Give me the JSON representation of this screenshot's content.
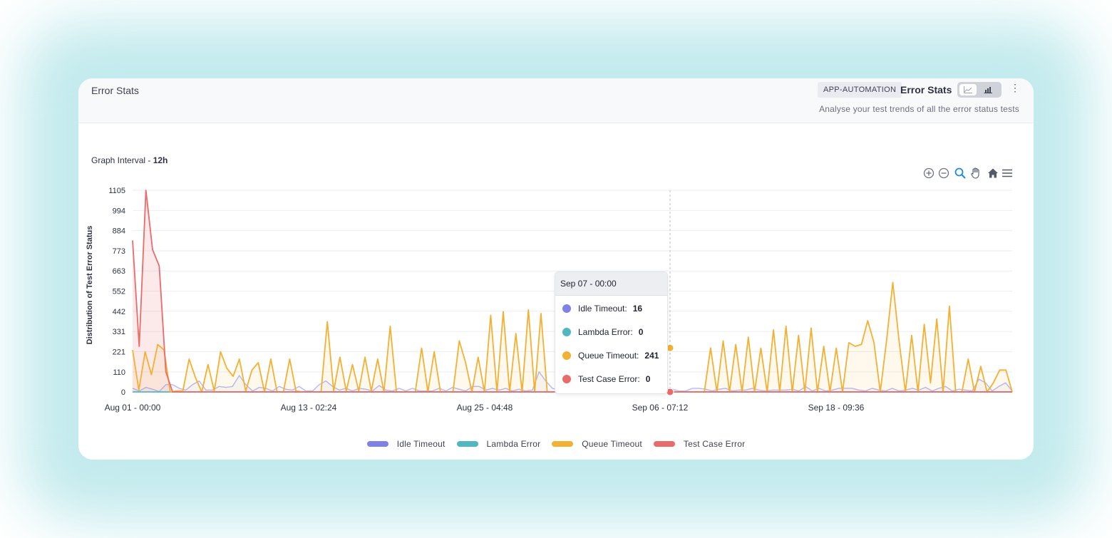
{
  "card": {
    "title": "Error Stats",
    "tag": "APP-AUTOMATION",
    "header_title": "Error Stats",
    "subtitle": "Analyse your test trends of all the error status tests",
    "interval_label": "Graph Interval - ",
    "interval_value": "12h"
  },
  "toolbar": {
    "icons": [
      "zoom-in-icon",
      "zoom-out-icon",
      "zoom-selection-icon",
      "pan-hand-icon",
      "home-reset-icon",
      "menu-icon"
    ]
  },
  "tooltip": {
    "title": "Sep 07 - 00:00",
    "rows": [
      {
        "label": "Idle Timeout:",
        "value": "16",
        "color": "#7f81e6"
      },
      {
        "label": "Lambda Error:",
        "value": "0",
        "color": "#4fb7c1"
      },
      {
        "label": "Queue Timeout:",
        "value": "241",
        "color": "#f2b134"
      },
      {
        "label": "Test Case Error:",
        "value": "0",
        "color": "#ea6b6b"
      }
    ]
  },
  "chart_data": {
    "type": "area",
    "ylabel": "Distribution of Test Error Status",
    "y_ticks": [
      "0",
      "110",
      "221",
      "331",
      "442",
      "552",
      "663",
      "773",
      "884",
      "994",
      "1105"
    ],
    "x_ticks": [
      "Aug 01 - 00:00",
      "Aug 13 - 02:24",
      "Aug 25 - 04:48",
      "Sep 06 - 07:12",
      "Sep 18 - 09:36"
    ],
    "ylim": [
      0,
      1105
    ],
    "x_range_hours": [
      0,
      1488
    ],
    "grid": true,
    "legend": "bottom-center",
    "series": [
      {
        "name": "Idle Timeout",
        "color": "#7f81e6",
        "values": [
          20,
          5,
          25,
          15,
          2,
          40,
          40,
          20,
          10,
          40,
          60,
          10,
          10,
          30,
          25,
          30,
          90,
          40,
          5,
          25,
          20,
          5,
          30,
          15,
          10,
          30,
          5,
          5,
          40,
          60,
          30,
          10,
          20,
          5,
          20,
          15,
          5,
          35,
          10,
          5,
          20,
          5,
          20,
          5,
          5,
          5,
          20,
          5,
          25,
          15,
          5,
          30,
          30,
          10,
          20,
          10,
          20,
          5,
          15,
          5,
          10,
          110,
          60,
          20,
          10,
          20,
          5,
          10,
          10,
          20,
          5,
          10,
          25,
          10,
          10,
          5,
          20,
          10,
          5,
          5,
          20,
          15,
          5,
          5,
          20,
          20,
          15,
          5,
          15,
          20,
          5,
          10,
          10,
          20,
          10,
          5,
          10,
          10,
          10,
          15,
          5,
          30,
          5,
          20,
          5,
          10,
          20,
          20,
          20,
          10,
          5,
          20,
          10,
          5,
          20,
          5,
          10,
          20,
          10,
          25,
          5,
          20,
          30,
          5,
          15,
          10,
          5,
          70,
          50,
          5,
          30,
          50,
          5
        ]
      },
      {
        "name": "Lambda Error",
        "color": "#4fb7c1",
        "values": [
          0,
          0,
          0,
          0,
          0,
          0,
          0,
          0,
          0,
          0,
          0,
          0,
          0,
          0,
          0,
          0,
          0,
          0,
          0,
          0,
          0,
          0,
          0,
          0,
          0,
          0,
          0,
          0,
          0,
          0,
          0,
          0,
          0,
          0,
          0,
          0,
          0,
          0,
          0,
          0,
          0,
          0,
          0,
          0,
          0,
          0,
          0,
          0,
          0,
          0,
          0,
          0,
          0,
          0,
          0,
          0,
          0,
          0,
          0,
          0,
          0,
          0,
          0,
          0,
          0,
          0,
          0,
          0,
          0,
          0,
          0,
          0,
          0,
          0,
          0,
          0,
          0,
          0,
          0,
          0,
          0,
          0,
          0,
          0,
          0,
          0,
          0,
          0,
          0,
          0,
          0,
          0,
          0,
          0,
          0,
          0,
          0,
          0,
          0,
          0,
          0,
          0,
          0,
          0,
          0,
          0,
          0,
          0,
          0,
          0,
          0,
          0,
          0,
          0,
          0,
          0,
          0,
          0,
          0,
          0,
          0,
          0,
          0,
          0,
          0,
          0,
          0,
          0,
          0,
          0,
          0,
          0,
          0,
          0
        ]
      },
      {
        "name": "Queue Timeout",
        "color": "#f2b134",
        "values": [
          230,
          10,
          220,
          95,
          260,
          230,
          0,
          5,
          5,
          180,
          80,
          0,
          150,
          5,
          220,
          130,
          85,
          180,
          5,
          120,
          160,
          0,
          180,
          0,
          0,
          180,
          5,
          0,
          0,
          0,
          0,
          385,
          5,
          190,
          5,
          150,
          5,
          190,
          5,
          180,
          0,
          360,
          0,
          0,
          0,
          0,
          240,
          0,
          220,
          0,
          0,
          0,
          280,
          160,
          0,
          190,
          0,
          420,
          0,
          440,
          0,
          320,
          0,
          450,
          0,
          430,
          0,
          0,
          0,
          0,
          0,
          0,
          0,
          0,
          0,
          0,
          0,
          0,
          0,
          0,
          0,
          0,
          0,
          0,
          0,
          0,
          0,
          0,
          0,
          0,
          0,
          0,
          241,
          0,
          280,
          0,
          260,
          0,
          300,
          0,
          240,
          0,
          340,
          0,
          360,
          0,
          310,
          0,
          350,
          0,
          250,
          0,
          240,
          0,
          270,
          250,
          260,
          390,
          270,
          0,
          280,
          600,
          280,
          0,
          310,
          0,
          370,
          50,
          400,
          0,
          470,
          0,
          0,
          180,
          0,
          140,
          0,
          50,
          120,
          120,
          0
        ]
      },
      {
        "name": "Test Case Error",
        "color": "#ea6b6b",
        "values": [
          830,
          250,
          1105,
          780,
          690,
          110,
          0,
          0,
          0,
          0,
          0,
          0,
          0,
          0,
          0,
          0,
          0,
          0,
          0,
          0,
          0,
          0,
          0,
          0,
          0,
          0,
          0,
          0,
          0,
          0,
          0,
          0,
          0,
          0,
          0,
          0,
          0,
          0,
          0,
          0,
          0,
          0,
          0,
          0,
          0,
          0,
          0,
          0,
          0,
          0,
          0,
          0,
          0,
          0,
          0,
          0,
          0,
          0,
          0,
          0,
          0,
          0,
          0,
          0,
          0,
          0,
          0,
          0,
          0,
          0,
          0,
          0,
          0,
          0,
          0,
          0,
          0,
          0,
          0,
          0,
          0,
          0,
          0,
          0,
          0,
          0,
          0,
          0,
          0,
          0,
          0,
          0,
          0,
          0,
          0,
          0,
          0,
          0,
          0,
          0,
          0,
          0,
          0,
          0,
          0,
          0,
          0,
          0,
          0,
          0,
          0,
          0,
          0,
          0,
          0,
          0,
          0,
          0,
          0,
          0,
          0,
          0,
          0,
          0,
          0,
          0,
          0,
          0,
          0,
          0,
          0,
          0,
          0
        ]
      }
    ]
  }
}
